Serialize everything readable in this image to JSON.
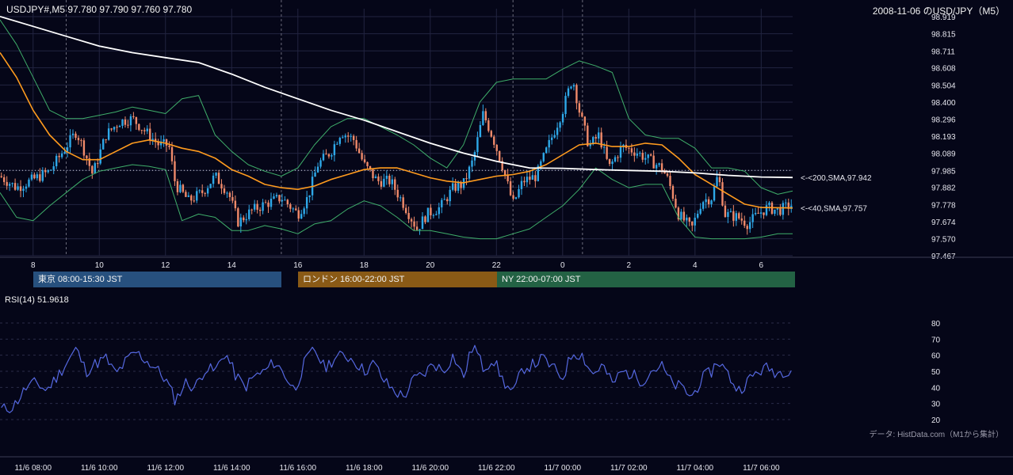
{
  "header": {
    "symbol_info": "USDJPY#,M5 97.780 97.790 97.760 97.780",
    "chart_title": "2008-11-06 のUSD/JPY（M5）"
  },
  "colors": {
    "background": "#050618",
    "grid": "#222440",
    "up_candle": "#2ea8e8",
    "down_candle": "#f08a6a",
    "sma200": "#ffffff",
    "sma40": "#ff9b1e",
    "bollinger": "#3fae6a",
    "rsi": "#5568e0",
    "tokyo": "#27507e",
    "london": "#8a5a16",
    "newyork": "#236244"
  },
  "sessions": {
    "tokyo": "東京 08:00-15:30 JST",
    "london": "ロンドン 16:00-22:00 JST",
    "newyork": "NY 22:00-07:00 JST"
  },
  "rsi_label": "RSI(14) 51.9618",
  "footer": {
    "source": "データ: HistData.com（M1から集計）"
  },
  "chart_data": [
    {
      "type": "candlestick",
      "title": "2008-11-06 のUSD/JPY（M5）",
      "ylim": [
        97.467,
        98.919
      ],
      "y_ticks": [
        "98.919",
        "98.815",
        "98.711",
        "98.608",
        "98.504",
        "98.400",
        "98.296",
        "98.193",
        "98.089",
        "97.985",
        "97.882",
        "97.778",
        "97.674",
        "97.570",
        "97.467"
      ],
      "x_ticks": [
        "8",
        "10",
        "12",
        "14",
        "16",
        "18",
        "20",
        "22",
        "0",
        "2",
        "4",
        "6"
      ],
      "x_hours": [
        8,
        10,
        12,
        14,
        16,
        18,
        20,
        22,
        24,
        26,
        28,
        30
      ],
      "x_range_hours": [
        7.0,
        30.95
      ],
      "last_price": 97.78,
      "reference_level": 97.985,
      "annotations": [
        {
          "text": "<-<200,SMA,97.942",
          "value": 97.942,
          "color": "#ffffff"
        },
        {
          "text": "<-<40,SMA,97.757",
          "value": 97.757,
          "color": "#ff9b1e"
        }
      ],
      "price_path": [
        [
          7.0,
          97.95
        ],
        [
          7.5,
          97.88
        ],
        [
          8.0,
          97.93
        ],
        [
          8.5,
          97.98
        ],
        [
          9.0,
          98.13
        ],
        [
          9.3,
          98.22
        ],
        [
          9.5,
          98.13
        ],
        [
          9.8,
          97.96
        ],
        [
          10.2,
          98.2
        ],
        [
          10.6,
          98.28
        ],
        [
          11.0,
          98.3
        ],
        [
          11.4,
          98.22
        ],
        [
          11.8,
          98.14
        ],
        [
          12.1,
          98.14
        ],
        [
          12.3,
          97.9
        ],
        [
          12.7,
          97.8
        ],
        [
          13.1,
          97.85
        ],
        [
          13.5,
          97.95
        ],
        [
          13.9,
          97.85
        ],
        [
          14.2,
          97.67
        ],
        [
          14.6,
          97.74
        ],
        [
          15.0,
          97.78
        ],
        [
          15.5,
          97.82
        ],
        [
          16.0,
          97.72
        ],
        [
          16.3,
          97.82
        ],
        [
          16.6,
          98.02
        ],
        [
          17.0,
          98.1
        ],
        [
          17.3,
          98.22
        ],
        [
          17.7,
          98.17
        ],
        [
          18.0,
          98.02
        ],
        [
          18.4,
          97.92
        ],
        [
          18.8,
          97.92
        ],
        [
          19.2,
          97.78
        ],
        [
          19.6,
          97.63
        ],
        [
          19.9,
          97.72
        ],
        [
          20.3,
          97.76
        ],
        [
          20.7,
          97.88
        ],
        [
          21.0,
          97.9
        ],
        [
          21.3,
          98.05
        ],
        [
          21.6,
          98.33
        ],
        [
          21.9,
          98.18
        ],
        [
          22.2,
          98.0
        ],
        [
          22.5,
          97.78
        ],
        [
          22.8,
          97.92
        ],
        [
          23.2,
          97.95
        ],
        [
          23.6,
          98.15
        ],
        [
          24.0,
          98.35
        ],
        [
          24.3,
          98.55
        ],
        [
          24.5,
          98.35
        ],
        [
          24.8,
          98.13
        ],
        [
          25.1,
          98.2
        ],
        [
          25.4,
          98.0
        ],
        [
          25.8,
          98.13
        ],
        [
          26.2,
          98.1
        ],
        [
          26.6,
          98.05
        ],
        [
          27.0,
          98.0
        ],
        [
          27.2,
          97.92
        ],
        [
          27.5,
          97.72
        ],
        [
          27.9,
          97.63
        ],
        [
          28.2,
          97.8
        ],
        [
          28.5,
          97.82
        ],
        [
          28.7,
          97.96
        ],
        [
          28.9,
          97.72
        ],
        [
          29.3,
          97.7
        ],
        [
          29.6,
          97.66
        ],
        [
          29.9,
          97.72
        ],
        [
          30.2,
          97.76
        ],
        [
          30.5,
          97.74
        ],
        [
          30.95,
          97.78
        ]
      ],
      "series": [
        {
          "name": "SMA200",
          "color": "#ffffff",
          "x": [
            7.0,
            8,
            9,
            10,
            11,
            12,
            13,
            14,
            15,
            16,
            17,
            18,
            19,
            20,
            21,
            22,
            23,
            24,
            25,
            26,
            27,
            28,
            29,
            30,
            30.95
          ],
          "values": [
            98.92,
            98.86,
            98.8,
            98.74,
            98.7,
            98.67,
            98.64,
            98.57,
            98.49,
            98.42,
            98.35,
            98.29,
            98.22,
            98.15,
            98.09,
            98.04,
            98.0,
            97.998,
            97.99,
            97.985,
            97.98,
            97.97,
            97.955,
            97.945,
            97.942
          ]
        },
        {
          "name": "SMA40",
          "color": "#ff9b1e",
          "x": [
            7.0,
            7.5,
            8,
            8.5,
            9,
            9.5,
            10,
            10.5,
            11,
            11.5,
            12,
            12.5,
            13,
            13.5,
            14,
            14.5,
            15,
            15.5,
            16,
            16.5,
            17,
            17.5,
            18,
            18.5,
            19,
            19.5,
            20,
            20.5,
            21,
            21.5,
            22,
            22.5,
            23,
            23.5,
            24,
            24.5,
            25,
            25.5,
            26,
            26.5,
            27,
            27.5,
            28,
            28.5,
            29,
            29.5,
            30,
            30.95
          ],
          "values": [
            98.7,
            98.55,
            98.35,
            98.2,
            98.1,
            98.05,
            98.05,
            98.1,
            98.15,
            98.17,
            98.15,
            98.12,
            98.1,
            98.06,
            97.99,
            97.95,
            97.9,
            97.88,
            97.87,
            97.89,
            97.93,
            97.96,
            97.99,
            98.0,
            98.0,
            97.97,
            97.94,
            97.92,
            97.91,
            97.93,
            97.95,
            97.96,
            97.98,
            98.02,
            98.08,
            98.14,
            98.15,
            98.13,
            98.13,
            98.15,
            98.14,
            98.06,
            97.96,
            97.9,
            97.84,
            97.78,
            97.76,
            97.757
          ]
        },
        {
          "name": "Bollinger upper",
          "color": "#3fae6a",
          "x": [
            7.0,
            7.5,
            8,
            8.5,
            9,
            9.5,
            10,
            10.5,
            11,
            11.5,
            12,
            12.5,
            13,
            13.5,
            14,
            14.5,
            15,
            15.5,
            16,
            16.5,
            17,
            17.5,
            18,
            18.5,
            19,
            19.5,
            20,
            20.5,
            21,
            21.5,
            22,
            22.5,
            23,
            23.5,
            24,
            24.5,
            25,
            25.5,
            26,
            26.5,
            27,
            27.5,
            28,
            28.5,
            29,
            29.5,
            30,
            30.5,
            30.95
          ],
          "values": [
            98.9,
            98.75,
            98.55,
            98.35,
            98.3,
            98.3,
            98.32,
            98.34,
            98.37,
            98.35,
            98.33,
            98.42,
            98.44,
            98.2,
            98.1,
            98.02,
            97.98,
            97.95,
            98.0,
            98.14,
            98.25,
            98.3,
            98.3,
            98.25,
            98.2,
            98.14,
            98.06,
            98.0,
            98.14,
            98.4,
            98.52,
            98.54,
            98.54,
            98.54,
            98.6,
            98.65,
            98.62,
            98.58,
            98.3,
            98.2,
            98.18,
            98.18,
            98.12,
            98.0,
            98.0,
            97.98,
            97.88,
            97.84,
            97.86
          ]
        },
        {
          "name": "Bollinger lower",
          "color": "#3fae6a",
          "x": [
            7.0,
            7.5,
            8,
            8.5,
            9,
            9.5,
            10,
            10.5,
            11,
            11.5,
            12,
            12.5,
            13,
            13.5,
            14,
            14.5,
            15,
            15.5,
            16,
            16.5,
            17,
            17.5,
            18,
            18.5,
            19,
            19.5,
            20,
            20.5,
            21,
            21.5,
            22,
            22.5,
            23,
            23.5,
            24,
            24.5,
            25,
            25.5,
            26,
            26.5,
            27,
            27.5,
            28,
            28.5,
            29,
            29.5,
            30,
            30.5,
            30.95
          ],
          "values": [
            97.85,
            97.7,
            97.68,
            97.77,
            97.85,
            97.93,
            97.98,
            98.0,
            98.02,
            98.01,
            97.99,
            97.68,
            97.72,
            97.7,
            97.62,
            97.62,
            97.65,
            97.63,
            97.6,
            97.66,
            97.68,
            97.75,
            97.8,
            97.77,
            97.7,
            97.62,
            97.62,
            97.6,
            97.58,
            97.57,
            97.57,
            97.6,
            97.63,
            97.7,
            97.77,
            97.87,
            98.0,
            97.93,
            97.88,
            97.9,
            97.9,
            97.7,
            97.58,
            97.57,
            97.57,
            97.57,
            97.58,
            97.6,
            97.6
          ]
        }
      ]
    },
    {
      "type": "line",
      "title": "RSI(14) 51.9618",
      "ylim": [
        20,
        80
      ],
      "y_ticks": [
        80,
        70,
        60,
        50,
        40,
        30,
        20
      ],
      "x_ticks": [
        "11/6 08:00",
        "11/6 10:00",
        "11/6 12:00",
        "11/6 14:00",
        "11/6 16:00",
        "11/6 18:00",
        "11/6 20:00",
        "11/6 22:00",
        "11/7 00:00",
        "11/7 02:00",
        "11/7 04:00",
        "11/7 06:00"
      ],
      "x_hours": [
        8,
        10,
        12,
        14,
        16,
        18,
        20,
        22,
        24,
        26,
        28,
        30
      ],
      "x_range_hours": [
        7.0,
        30.95
      ],
      "series": [
        {
          "name": "RSI(14)",
          "color": "#5568e0",
          "x": [
            7.0,
            7.4,
            7.8,
            8.1,
            8.4,
            8.7,
            9.0,
            9.3,
            9.6,
            9.9,
            10.2,
            10.5,
            10.8,
            11.1,
            11.4,
            11.7,
            12.0,
            12.3,
            12.6,
            12.9,
            13.2,
            13.5,
            13.8,
            14.1,
            14.4,
            14.7,
            15.0,
            15.3,
            15.6,
            15.9,
            16.2,
            16.5,
            16.8,
            17.1,
            17.4,
            17.7,
            18.0,
            18.3,
            18.6,
            18.9,
            19.2,
            19.5,
            19.8,
            20.1,
            20.4,
            20.7,
            21.0,
            21.3,
            21.6,
            21.9,
            22.2,
            22.5,
            22.8,
            23.1,
            23.4,
            23.7,
            24.0,
            24.3,
            24.6,
            24.9,
            25.2,
            25.5,
            25.8,
            26.1,
            26.4,
            26.7,
            27.0,
            27.3,
            27.6,
            27.9,
            28.2,
            28.5,
            28.7,
            29.0,
            29.3,
            29.6,
            29.9,
            30.2,
            30.5,
            30.95
          ],
          "values": [
            26,
            28,
            40,
            43,
            38,
            46,
            55,
            64,
            50,
            55,
            58,
            48,
            56,
            62,
            57,
            52,
            45,
            32,
            43,
            40,
            52,
            50,
            62,
            48,
            40,
            47,
            50,
            56,
            48,
            38,
            55,
            64,
            52,
            58,
            60,
            57,
            50,
            55,
            44,
            38,
            34,
            45,
            48,
            55,
            50,
            60,
            46,
            67,
            52,
            58,
            44,
            36,
            52,
            54,
            58,
            52,
            46,
            62,
            60,
            48,
            54,
            42,
            50,
            48,
            44,
            51,
            53,
            42,
            40,
            34,
            45,
            50,
            57,
            48,
            38,
            44,
            50,
            52,
            49,
            52
          ]
        }
      ]
    }
  ]
}
